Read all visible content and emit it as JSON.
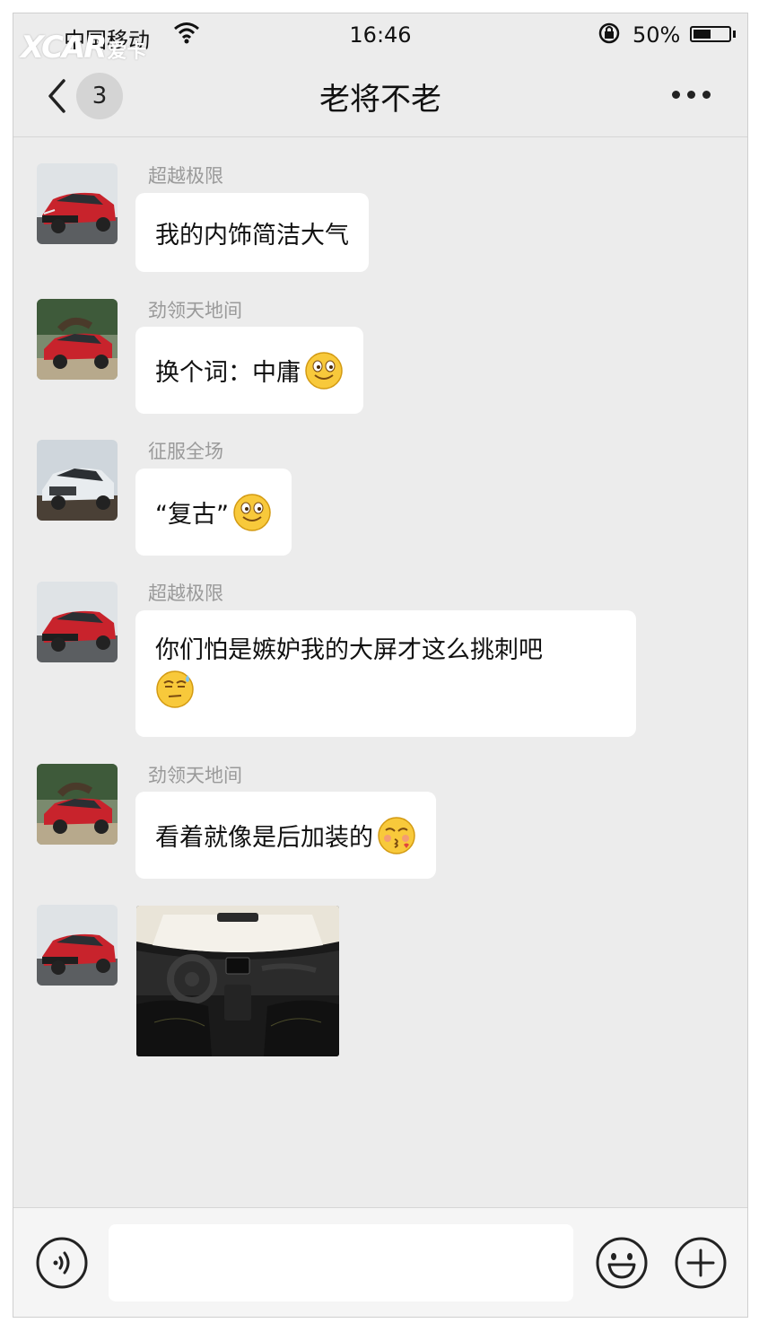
{
  "watermark": {
    "logo": "XCAR",
    "text": "爱卡"
  },
  "status": {
    "carrier": "中国移动",
    "time": "16:46",
    "battery_text": "50%",
    "battery_level": 0.5
  },
  "nav": {
    "back_icon": "chevron-left-icon",
    "unread_count": "3",
    "title": "老将不老",
    "more_icon": "more-icon"
  },
  "messages": [
    {
      "sender": "超越极限",
      "text": "我的内饰简洁大气",
      "emoji": ""
    },
    {
      "sender": "劲领天地间",
      "text": "换个词：中庸",
      "emoji": "smile-emoji"
    },
    {
      "sender": "征服全场",
      "text": "“复古”",
      "emoji": "smile-emoji"
    },
    {
      "sender": "超越极限",
      "text": "你们怕是嫉妒我的大屏才这么挑刺吧",
      "emoji": "sweat-emoji"
    },
    {
      "sender": "劲领天地间",
      "text": "看着就像是后加装的",
      "emoji": "kiss-emoji"
    },
    {
      "sender": "",
      "type": "image",
      "content": "car-interior-photo"
    }
  ],
  "colors": {
    "background": "#ececec",
    "bubble": "#ffffff",
    "sender_text": "#9a9a9a",
    "avatar_red_car": "#c8232c",
    "avatar_white_car": "#e8ecef"
  },
  "input": {
    "placeholder": "",
    "voice_icon": "voice-icon",
    "emoji_icon": "emoji-icon",
    "plus_icon": "plus-icon"
  }
}
